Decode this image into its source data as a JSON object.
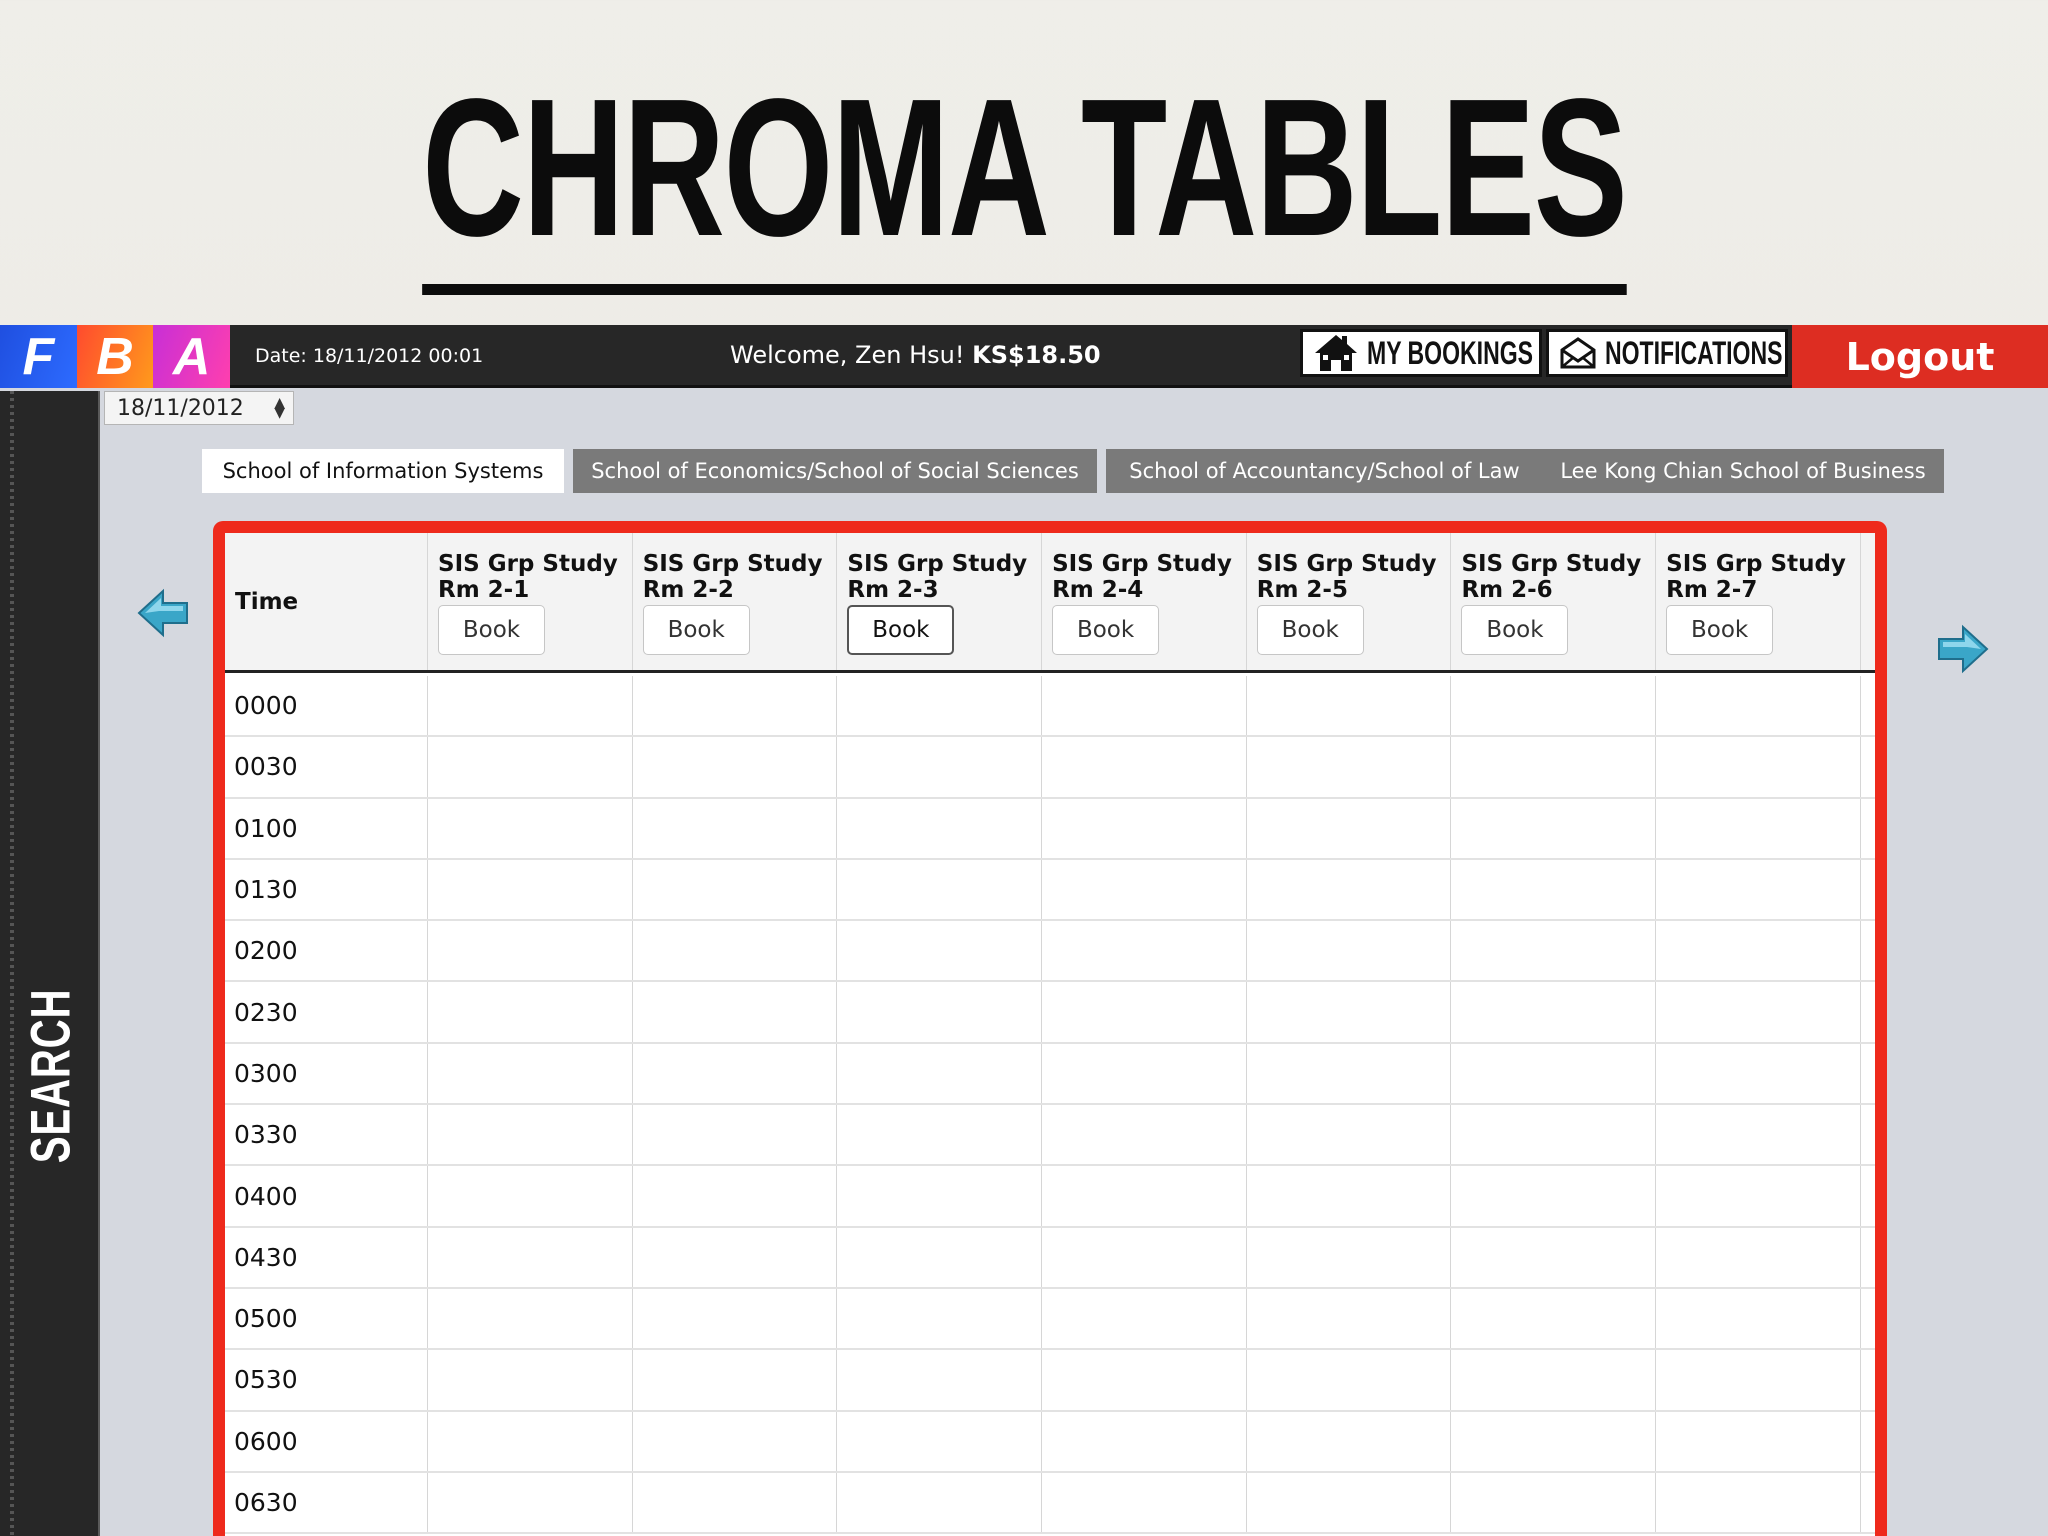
{
  "slide": {
    "title": "CHROMA TABLES"
  },
  "topbar": {
    "logo_letters": [
      "F",
      "B",
      "A"
    ],
    "date_label": "Date: 18/11/2012 00:01",
    "welcome_prefix": "Welcome, Zen Hsu!",
    "balance": "KS$18.50",
    "my_bookings_label": "MY BOOKINGS",
    "notifications_label": "NOTIFICATIONS",
    "logout_label": "Logout"
  },
  "sidebar": {
    "search_label": "SEARCH"
  },
  "date_select": {
    "value": "18/11/2012"
  },
  "tabs": [
    {
      "label": "School of Information Systems",
      "active": true
    },
    {
      "label": "School of Economics/School of Social Sciences",
      "active": false
    },
    {
      "label": "School of Accountancy/School of Law",
      "active": false
    },
    {
      "label": "Lee Kong Chian School of Business",
      "active": false
    }
  ],
  "table": {
    "time_header": "Time",
    "book_label": "Book",
    "rooms": [
      {
        "line1": "SIS Grp Study",
        "line2": "Rm 2-1"
      },
      {
        "line1": "SIS Grp Study",
        "line2": "Rm 2-2"
      },
      {
        "line1": "SIS Grp Study",
        "line2": "Rm 2-3"
      },
      {
        "line1": "SIS Grp Study",
        "line2": "Rm 2-4"
      },
      {
        "line1": "SIS Grp Study",
        "line2": "Rm 2-5"
      },
      {
        "line1": "SIS Grp Study",
        "line2": "Rm 2-6"
      },
      {
        "line1": "SIS Grp Study",
        "line2": "Rm 2-7"
      }
    ],
    "times": [
      "0000",
      "0030",
      "0100",
      "0130",
      "0200",
      "0230",
      "0300",
      "0330",
      "0400",
      "0430",
      "0500",
      "0530",
      "0600",
      "0630"
    ]
  },
  "colors": {
    "highlight_frame": "#ee2a1c",
    "logout_bg": "#dd2d22",
    "topbar_bg": "#272727",
    "arrow": "#3aa6c8"
  },
  "icons": {
    "my_bookings": "house-icon",
    "notifications": "envelope-icon",
    "prev": "arrow-left-icon",
    "next": "arrow-right-icon"
  }
}
